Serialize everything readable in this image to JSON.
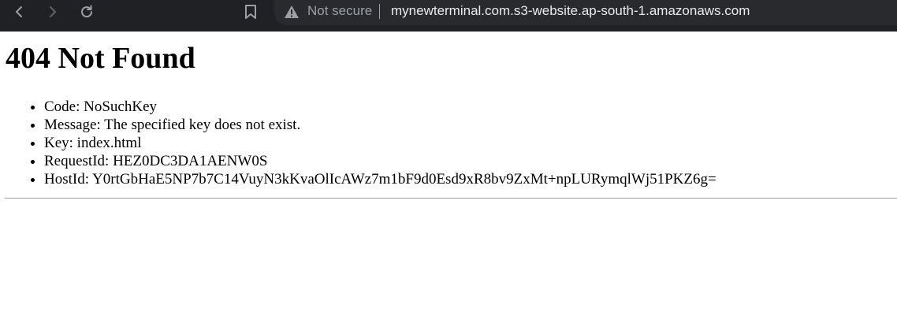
{
  "browser": {
    "security_label": "Not secure",
    "url": "mynewterminal.com.s3-website.ap-south-1.amazonaws.com",
    "icons": [
      "back-icon",
      "forward-icon",
      "reload-icon",
      "bookmark-icon",
      "warning-icon"
    ]
  },
  "page": {
    "heading": "404 Not Found",
    "items": [
      "Code: NoSuchKey",
      "Message: The specified key does not exist.",
      "Key: index.html",
      "RequestId: HEZ0DC3DA1AENW0S",
      "HostId: Y0rtGbHaE5NP7b7C14VuyN3kKvaOlIcAWz7m1bF9d0Esd9xR8bv9ZxMt+npLURymqlWj51PKZ6g="
    ]
  },
  "colors": {
    "toolbar_bg": "#202124",
    "omnibox_bg": "#282a2d",
    "icon": "#9aa0a6",
    "url_text": "#e8eaed"
  }
}
